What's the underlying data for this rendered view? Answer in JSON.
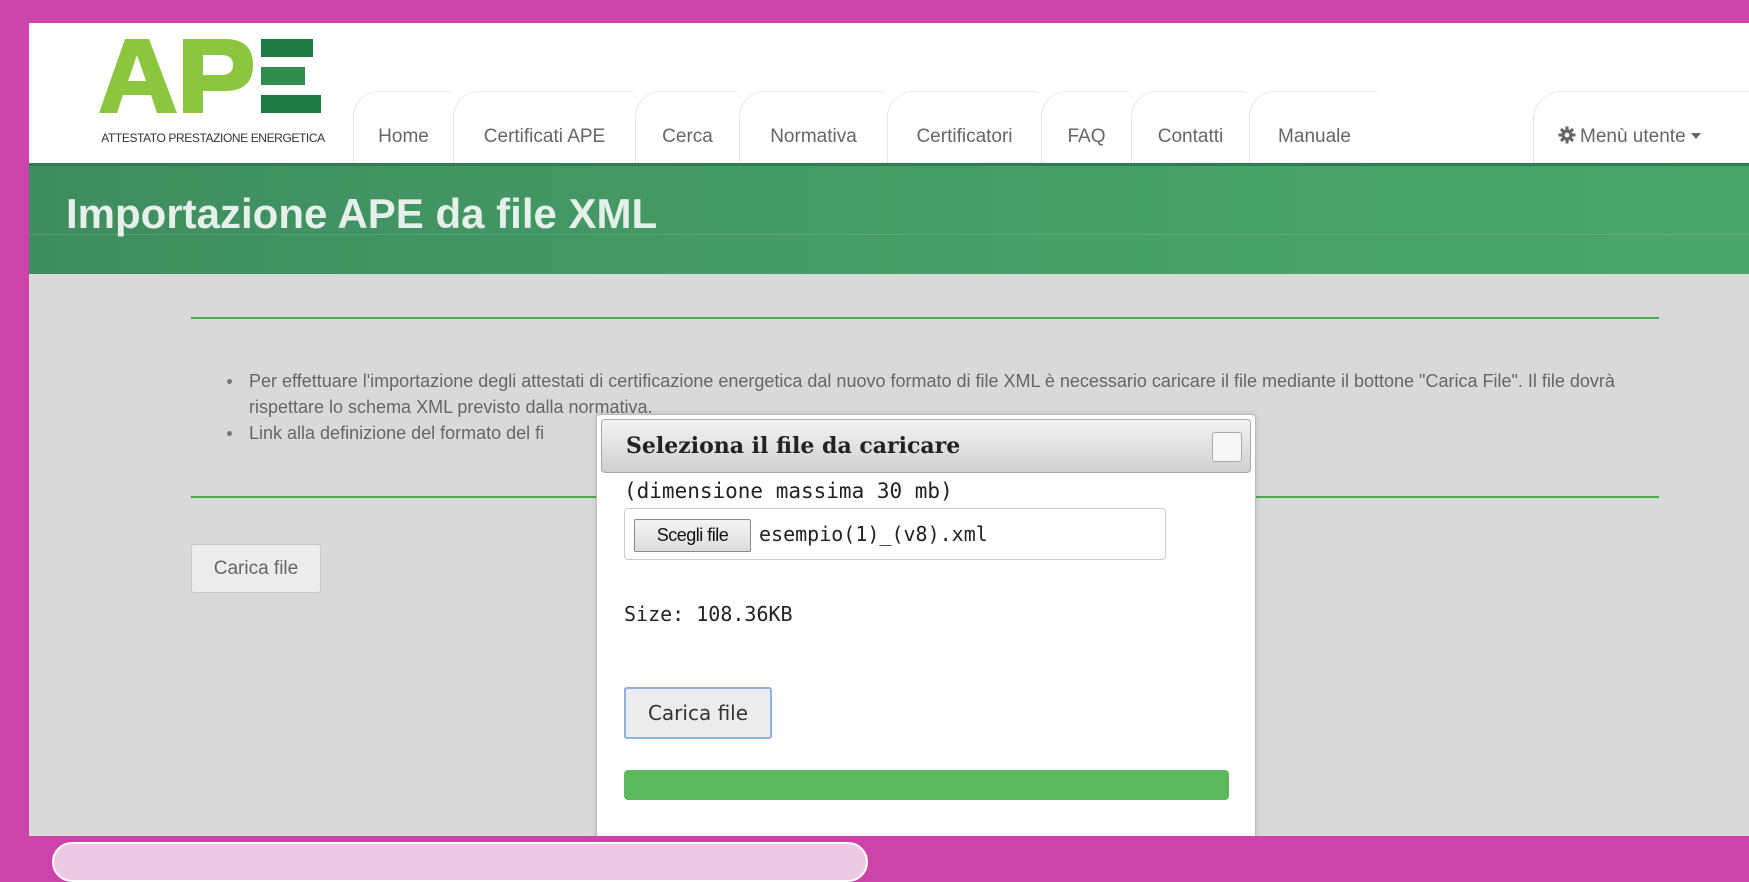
{
  "logo": {
    "letters": "APE",
    "subtitle": "ATTESTATO PRESTAZIONE ENERGETICA",
    "colors": {
      "light_green": "#8cc63f",
      "dark_green": "#1f7a45"
    }
  },
  "nav": {
    "tabs": [
      {
        "label": "Home"
      },
      {
        "label": "Certificati APE"
      },
      {
        "label": "Cerca"
      },
      {
        "label": "Normativa"
      },
      {
        "label": "Certificatori"
      },
      {
        "label": "FAQ"
      },
      {
        "label": "Contatti"
      },
      {
        "label": "Manuale"
      }
    ],
    "user_menu": {
      "label": "Menù utente",
      "icon": "gear-icon"
    }
  },
  "page": {
    "title": "Importazione APE da file XML",
    "accent_color": "#46a068"
  },
  "info": {
    "items": [
      "Per effettuare l'importazione degli attestati di certificazione energetica dal nuovo formato di file XML è necessario caricare il file mediante il bottone \"Carica File\". Il file dovrà rispettare lo schema XML previsto dalla normativa.",
      "Link alla definizione del formato del fi"
    ]
  },
  "main": {
    "upload_button": "Carica file"
  },
  "dialog": {
    "title": "Seleziona il file da caricare",
    "hint": "(dimensione massima 30 mb)",
    "choose_button": "Scegli file",
    "file_name": "esempio(1)_(v8).xml",
    "file_size": "Size: 108.36KB",
    "upload_button": "Carica file",
    "progress": 1.0,
    "progress_color": "#5cb85c"
  }
}
